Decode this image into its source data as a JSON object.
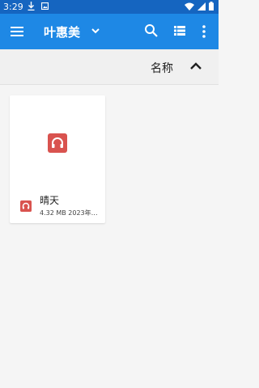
{
  "status_bar": {
    "time": "3:29",
    "icons_left": [
      "download-icon",
      "photo-icon"
    ],
    "icons_right": [
      "wifi-icon",
      "signal-icon",
      "battery-icon"
    ]
  },
  "app_bar": {
    "title": "叶惠美",
    "actions": [
      "menu-icon",
      "chevron-down-icon",
      "search-icon",
      "list-view-icon",
      "more-vert-icon"
    ]
  },
  "sort": {
    "label": "名称",
    "direction_icon": "chevron-up-icon"
  },
  "files": [
    {
      "name": "晴天",
      "meta": "4.32 MB 2023年…",
      "icon": "headphones-icon"
    }
  ],
  "colors": {
    "status_bar": "#1565c0",
    "app_bar": "#1e88e5",
    "audio_icon": "#d9534f",
    "background": "#f5f5f5"
  }
}
